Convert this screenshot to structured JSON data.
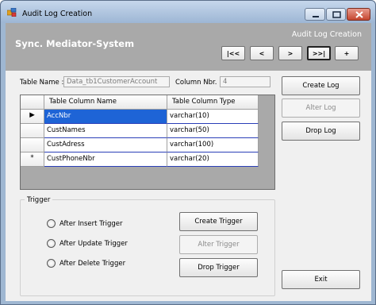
{
  "window": {
    "title": "Audit Log Creation",
    "controls": [
      "minimize",
      "maximize",
      "close"
    ]
  },
  "header": {
    "system_title": "Sync. Mediator-System",
    "form_title": "Audit Log Creation",
    "nav_buttons": [
      {
        "label": "|<<",
        "active": false
      },
      {
        "label": "<",
        "active": false
      },
      {
        "label": ">",
        "active": false
      },
      {
        "label": ">>|",
        "active": true
      },
      {
        "label": "+",
        "active": false
      }
    ]
  },
  "fields": {
    "table_name_label": "Table Name :",
    "table_name_value": "Data_tb1CustomerAccount",
    "column_nbr_label": "Column Nbr. :",
    "column_nbr_value": "4"
  },
  "grid": {
    "headers": [
      "Table Column Name",
      "Table Column Type"
    ],
    "rows": [
      {
        "indicator": "▶",
        "name": "AccNbr",
        "type": "varchar(10)",
        "selected": true
      },
      {
        "indicator": "",
        "name": "CustNames",
        "type": "varchar(50)",
        "selected": false
      },
      {
        "indicator": "",
        "name": "CustAdress",
        "type": "varchar(100)",
        "selected": false
      },
      {
        "indicator": "*",
        "name": "CustPhoneNbr",
        "type": "varchar(20)",
        "selected": false
      }
    ]
  },
  "log_buttons": {
    "create": "Create Log",
    "alter": "Alter Log",
    "drop": "Drop Log"
  },
  "trigger": {
    "group_title": "Trigger",
    "options": [
      "After Insert Trigger",
      "After Update Trigger",
      "After Delete Trigger"
    ],
    "create": "Create Trigger",
    "alter": "Alter Trigger",
    "drop": "Drop Trigger"
  },
  "exit_label": "Exit",
  "colors": {
    "header_bg": "#a9a9a9",
    "selection": "#1e64d6",
    "window_frame": "#9fb7d2"
  }
}
